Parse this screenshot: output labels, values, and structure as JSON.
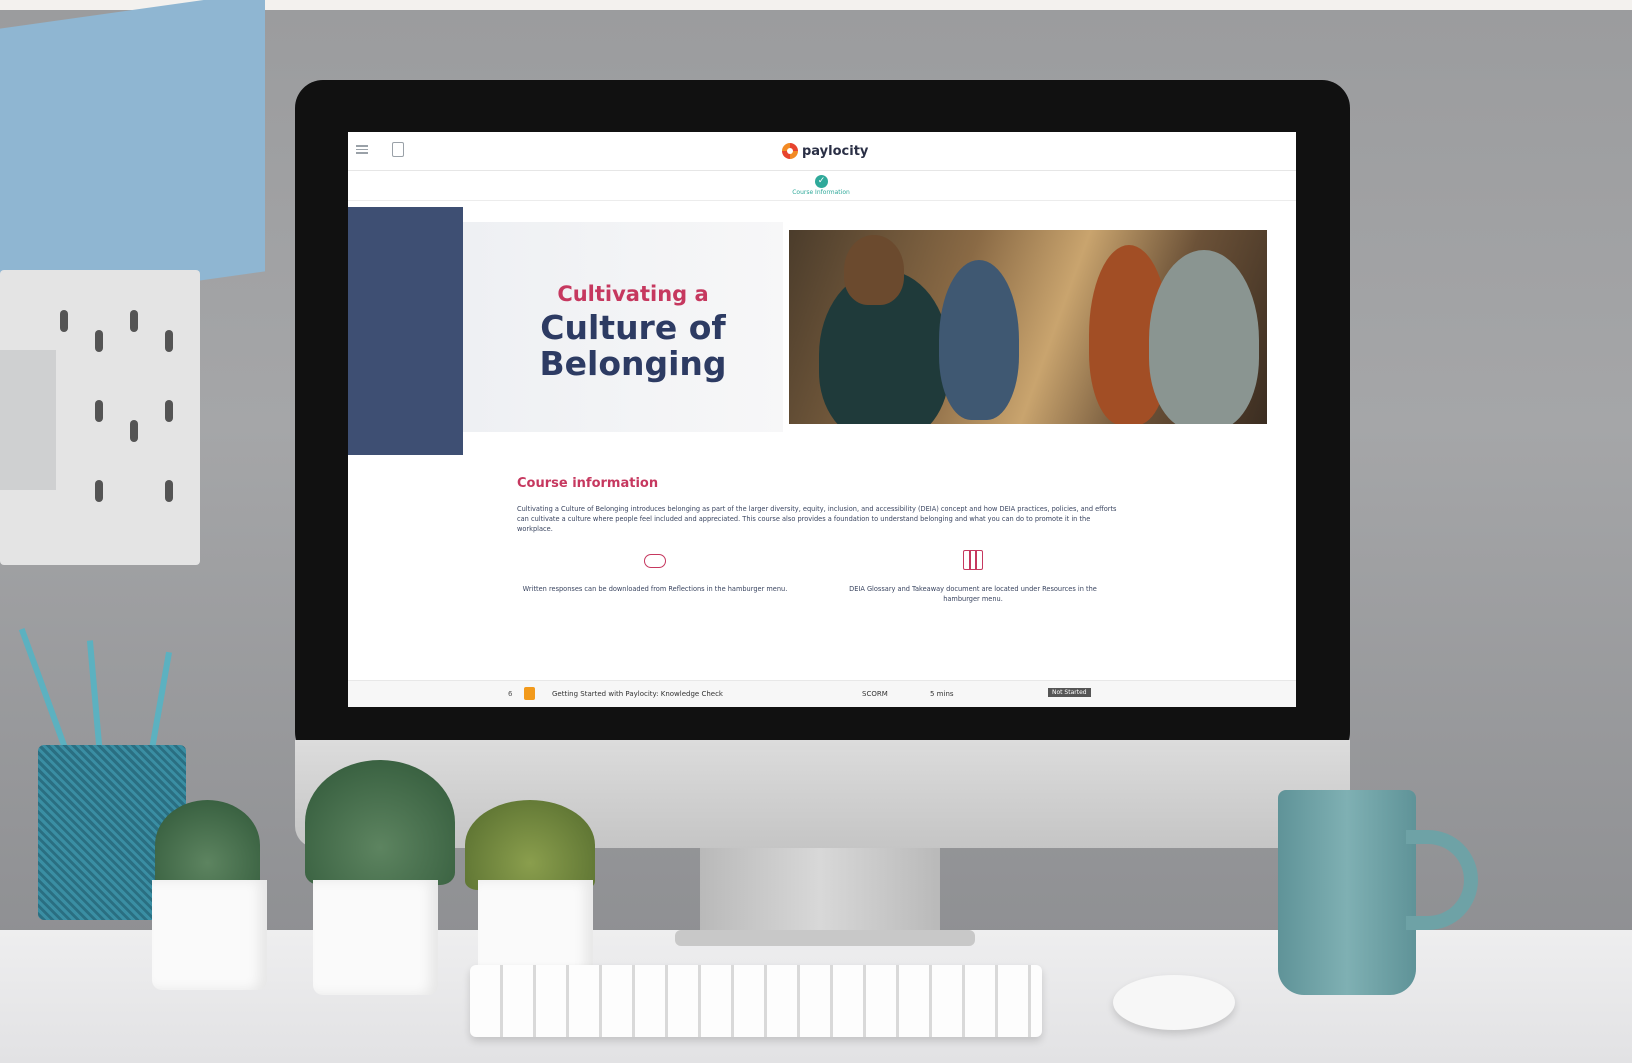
{
  "app": {
    "logo_text": "paylocity"
  },
  "progress": {
    "step_label": "Course Information"
  },
  "hero": {
    "line1": "Cultivating a",
    "line2a": "Culture of",
    "line2b": "Belonging"
  },
  "course_info": {
    "title": "Course information",
    "body": "Cultivating a Culture of Belonging introduces belonging as part of the larger diversity, equity, inclusion, and accessibility (DEIA) concept and how DEIA practices, policies, and efforts can cultivate a culture where people feel included and appreciated. This course also provides a foundation to understand belonging and what you can do to promote it in the workplace."
  },
  "info_blocks": [
    {
      "icon": "cloud-download-icon",
      "text": "Written responses can be downloaded from Reflections in the hamburger menu."
    },
    {
      "icon": "books-icon",
      "text": "DEIA Glossary and Takeaway document are located under Resources in the hamburger menu."
    }
  ],
  "list_row": {
    "number": "6",
    "title": "Getting Started with Paylocity: Knowledge Check",
    "type": "SCORM",
    "duration": "5 mins",
    "status": "Not Started"
  },
  "colors": {
    "accent_pink": "#c6385f",
    "navy": "#2d3b63",
    "teal": "#2fa99a"
  }
}
